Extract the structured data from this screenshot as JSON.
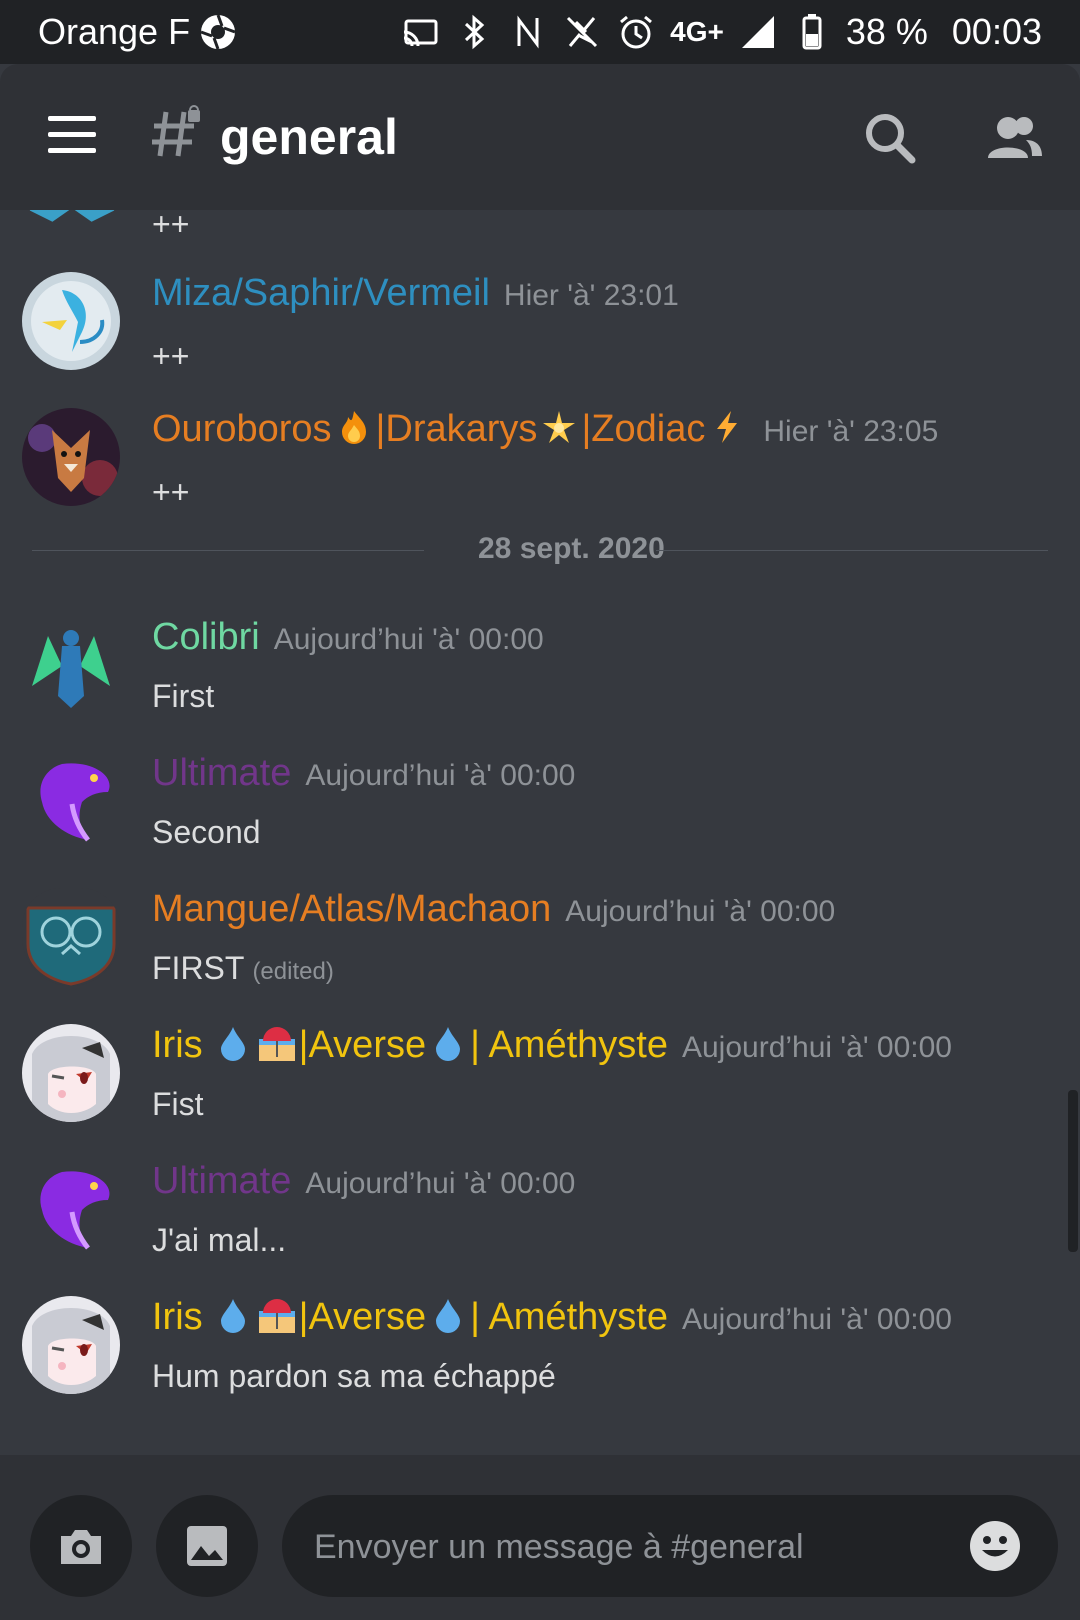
{
  "status_bar": {
    "carrier": "Orange F",
    "network": "4G+",
    "battery": "38 %",
    "time": "00:03",
    "icons": [
      "aperture-icon",
      "cast-icon",
      "bluetooth-icon",
      "nfc-icon",
      "no-flash-icon",
      "alarm-icon",
      "signal-icon",
      "battery-icon"
    ]
  },
  "header": {
    "channel_name": "general",
    "menu_icon": "hamburger-icon",
    "search_icon": "search-icon",
    "members_icon": "members-icon"
  },
  "messages": [
    {
      "username": "",
      "timestamp": "",
      "content": "++",
      "color": "#2e8fc0"
    },
    {
      "username": "Miza/Saphir/Vermeil",
      "timestamp": "Hier 'à' 23:01",
      "content": "++",
      "color": "#2e8fc0"
    },
    {
      "username_parts": [
        "Ouroboros",
        "|Drakarys",
        "|Zodiac"
      ],
      "timestamp": "Hier 'à' 23:05",
      "content": "++",
      "color": "#e67e22"
    },
    {
      "username": "Colibri",
      "timestamp": "Aujourd’hui 'à' 00:00",
      "content": "First",
      "color": "#6fd8a2"
    },
    {
      "username": "Ultimate",
      "timestamp": "Aujourd’hui 'à' 00:00",
      "content": "Second",
      "color": "#71368a"
    },
    {
      "username": "Mangue/Atlas/Machaon",
      "timestamp": "Aujourd’hui 'à' 00:00",
      "content": "FIRST",
      "edited": "(edited)",
      "color": "#e67e22"
    },
    {
      "username_parts": [
        "Iris",
        "|Averse",
        "| Améthyste"
      ],
      "timestamp": "Aujourd’hui 'à' 00:00",
      "content": "Fist",
      "color": "#f1c40f"
    },
    {
      "username": "Ultimate",
      "timestamp": "Aujourd’hui 'à' 00:00",
      "content": "J'ai mal...",
      "color": "#71368a"
    },
    {
      "username_parts": [
        "Iris",
        "|Averse",
        "| Améthyste"
      ],
      "timestamp": "Aujourd’hui 'à' 00:00",
      "content": "Hum pardon sa ma échappé",
      "color": "#f1c40f"
    }
  ],
  "date_divider": "28 sept. 2020",
  "composer": {
    "placeholder": "Envoyer un message à #general",
    "camera_icon": "camera-icon",
    "image_icon": "image-icon",
    "emoji_icon": "emoji-icon"
  },
  "colors": {
    "background": "#36393f",
    "header": "#2f3136",
    "status_bar": "#202225"
  }
}
